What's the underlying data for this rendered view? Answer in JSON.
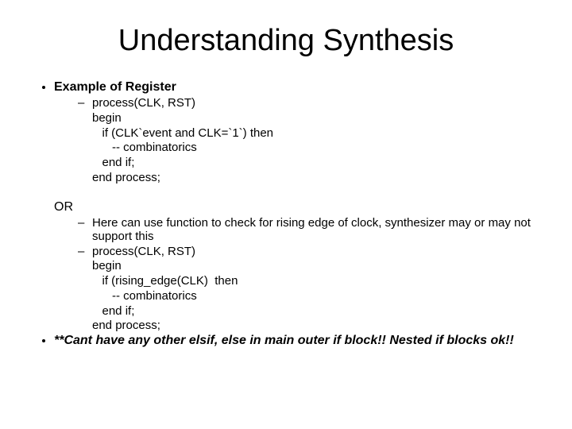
{
  "title": "Understanding Synthesis",
  "section1": {
    "heading": "Example of Register",
    "code_l1": "process(CLK, RST)",
    "code_l2": "begin",
    "code_l3": "   if (CLK`event and CLK=`1`) then",
    "code_l4": "      -- combinatorics",
    "code_l5": "   end if;",
    "code_l6": "end process;"
  },
  "or_label": "OR",
  "section2": {
    "note": "Here can use function to check for rising edge of clock, synthesizer may or may not support this",
    "code_l1": "process(CLK, RST)",
    "code_l2": "begin",
    "code_l3": "   if (rising_edge(CLK)  then",
    "code_l4": "      -- combinatorics",
    "code_l5": "   end if;",
    "code_l6": "end process;"
  },
  "warning": "**Cant have any other elsif, else in main outer if block!!  Nested if blocks ok!!"
}
